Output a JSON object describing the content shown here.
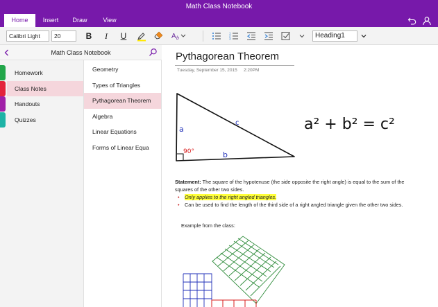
{
  "app": {
    "title": "Math Class Notebook"
  },
  "tabs": [
    {
      "label": "Home",
      "active": true
    },
    {
      "label": "Insert",
      "active": false
    },
    {
      "label": "Draw",
      "active": false
    },
    {
      "label": "View",
      "active": false
    }
  ],
  "ribbon": {
    "font_name": "Calibri Light",
    "font_size": "20",
    "style": "Heading1",
    "bold_icon": "bold-icon",
    "italic_icon": "italic-icon",
    "underline_icon": "underline-icon"
  },
  "notebook": {
    "name": "Math Class Notebook"
  },
  "sections": [
    {
      "label": "Homework",
      "color": "#22a64a",
      "active": false
    },
    {
      "label": "Class Notes",
      "color": "#e3243b",
      "active": true
    },
    {
      "label": "Handouts",
      "color": "#a020a8",
      "active": false
    },
    {
      "label": "Quizzes",
      "color": "#1eb3a6",
      "active": false
    }
  ],
  "pages": [
    {
      "label": "Geometry",
      "active": false
    },
    {
      "label": "Types of Triangles",
      "active": false
    },
    {
      "label": "Pythagorean Theorem",
      "active": true
    },
    {
      "label": "Algebra",
      "active": false
    },
    {
      "label": "Linear Equations",
      "active": false
    },
    {
      "label": "Forms of Linear Equa",
      "active": false
    }
  ],
  "page": {
    "title": "Pythagorean Theorem",
    "date": "Tuesday, September 15, 2015",
    "time": "2:20PM",
    "ink": {
      "side_a": "a",
      "side_b": "b",
      "side_c": "c",
      "angle": "90°",
      "equation": "a² + b² = c²"
    },
    "statement_label": "Statement:",
    "statement_text": " The square of the hypotenuse (the side opposite the right angle) is equal to the sum of the squares of the other two sides.",
    "bullets": [
      "Only applies to the right angled triangles.",
      "Can be used to find the length of the third side of a right angled triangle given the other two sides."
    ],
    "example_label": "Example from the class:"
  },
  "colors": {
    "accent": "#7719aa",
    "selected_row": "#f5d6dc",
    "ink_blue": "#1f2fb8",
    "ink_red": "#d81b1b",
    "ink_green": "#2e8b3a"
  }
}
